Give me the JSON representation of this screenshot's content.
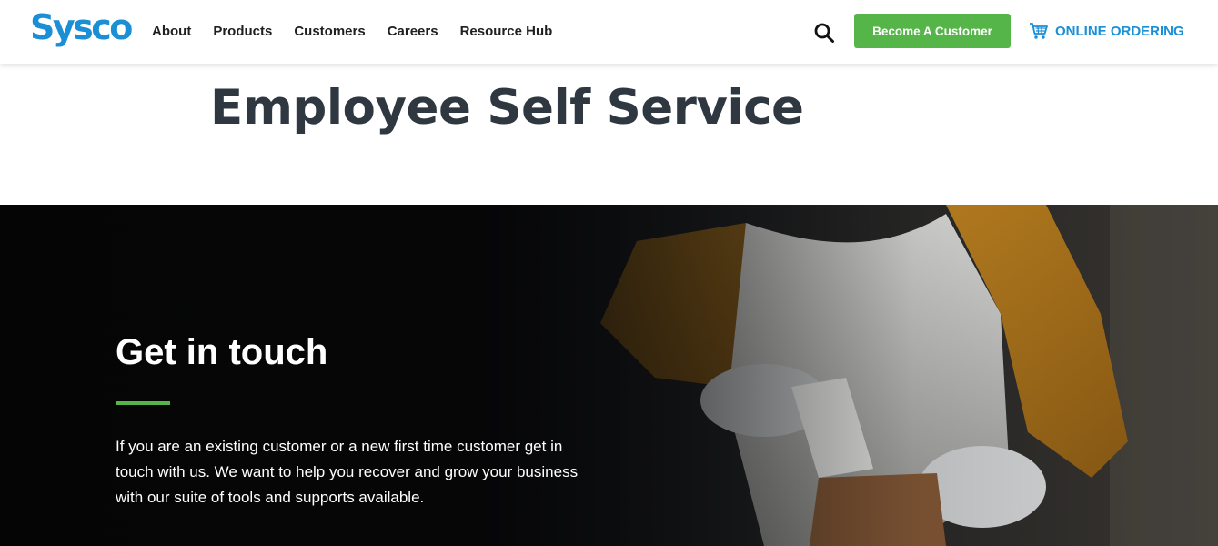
{
  "header": {
    "logo_text": "Sysco",
    "nav": [
      {
        "label": "About"
      },
      {
        "label": "Products"
      },
      {
        "label": "Customers"
      },
      {
        "label": "Careers"
      },
      {
        "label": "Resource Hub"
      }
    ],
    "search_icon": "search-icon",
    "cta_label": "Become A Customer",
    "online_ordering_label": "ONLINE ORDERING",
    "cart_icon": "cart-icon"
  },
  "page": {
    "title": "Employee Self Service"
  },
  "hero": {
    "heading": "Get in touch",
    "body": "If you are an existing customer or a new first time customer get in touch with us. We want to help you recover and grow your business with our suite of tools and supports available."
  },
  "colors": {
    "brand_blue": "#1a8fd6",
    "cta_green": "#56b548",
    "title_dark": "#2f3841",
    "hero_bg": "#0a0a0b"
  }
}
